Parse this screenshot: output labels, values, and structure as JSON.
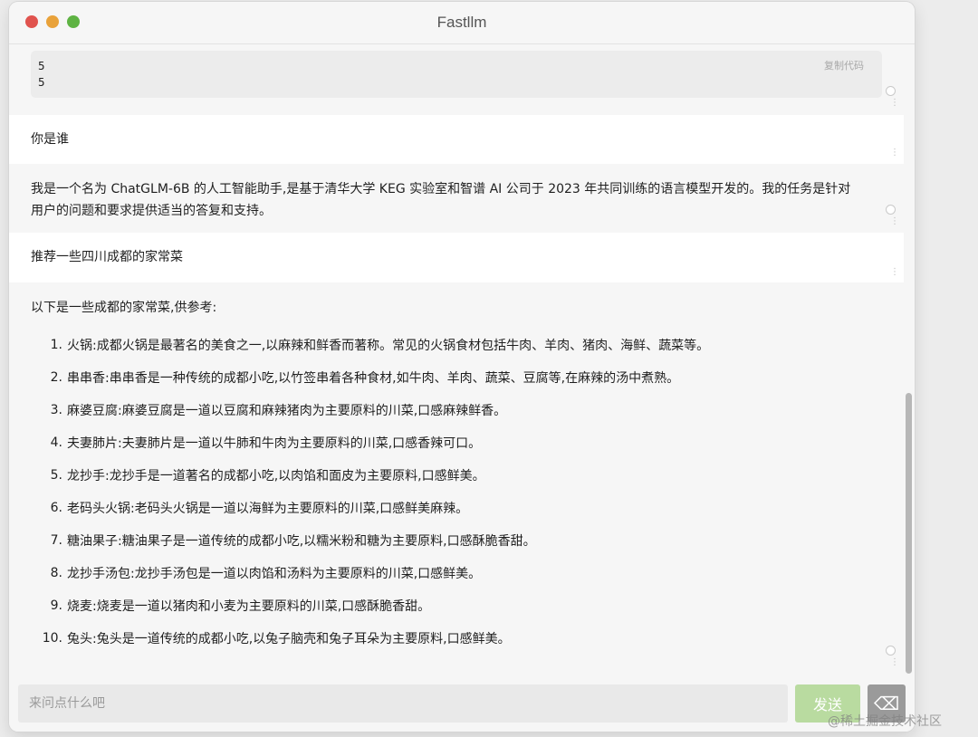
{
  "window": {
    "title": "Fastllm"
  },
  "code_block": {
    "lines": [
      "5",
      "5"
    ],
    "copy_label": "复制代码"
  },
  "messages": [
    {
      "role": "user",
      "text": "你是谁"
    },
    {
      "role": "assistant",
      "lines": [
        "我是一个名为 ChatGLM-6B 的人工智能助手,是基于清华大学 KEG 实验室和智谱 AI 公司于 2023 年共同训练的语言模型开发的。我的任务是针对",
        "用户的问题和要求提供适当的答复和支持。"
      ]
    },
    {
      "role": "user",
      "text": "推荐一些四川成都的家常菜"
    },
    {
      "role": "assistant",
      "intro": "以下是一些成都的家常菜,供参考:",
      "items": [
        {
          "num": "1.",
          "text": "火锅:成都火锅是最著名的美食之一,以麻辣和鲜香而著称。常见的火锅食材包括牛肉、羊肉、猪肉、海鲜、蔬菜等。"
        },
        {
          "num": "2.",
          "text": "串串香:串串香是一种传统的成都小吃,以竹签串着各种食材,如牛肉、羊肉、蔬菜、豆腐等,在麻辣的汤中煮熟。"
        },
        {
          "num": "3.",
          "text": "麻婆豆腐:麻婆豆腐是一道以豆腐和麻辣猪肉为主要原料的川菜,口感麻辣鲜香。"
        },
        {
          "num": "4.",
          "text": "夫妻肺片:夫妻肺片是一道以牛肺和牛肉为主要原料的川菜,口感香辣可口。"
        },
        {
          "num": "5.",
          "text": "龙抄手:龙抄手是一道著名的成都小吃,以肉馅和面皮为主要原料,口感鲜美。"
        },
        {
          "num": "6.",
          "text": "老码头火锅:老码头火锅是一道以海鲜为主要原料的川菜,口感鲜美麻辣。"
        },
        {
          "num": "7.",
          "text": "糖油果子:糖油果子是一道传统的成都小吃,以糯米粉和糖为主要原料,口感酥脆香甜。"
        },
        {
          "num": "8.",
          "text": "龙抄手汤包:龙抄手汤包是一道以肉馅和汤料为主要原料的川菜,口感鲜美。"
        },
        {
          "num": "9.",
          "text": "烧麦:烧麦是一道以猪肉和小麦为主要原料的川菜,口感酥脆香甜。"
        },
        {
          "num": "10.",
          "text": "兔头:兔头是一道传统的成都小吃,以兔子脑壳和兔子耳朵为主要原料,口感鲜美。"
        }
      ]
    }
  ],
  "input": {
    "placeholder": "来问点什么吧",
    "value": ""
  },
  "send_button": {
    "label": "发送"
  },
  "extra_button": {
    "icon": "clear-icon",
    "glyph": "⌫"
  },
  "watermark": {
    "text": "@稀土掘金技术社区"
  },
  "colors": {
    "send_bg": "#b9dba0",
    "user_msg_bg": "#ffffff",
    "assistant_msg_bg": "#f6f6f6"
  }
}
